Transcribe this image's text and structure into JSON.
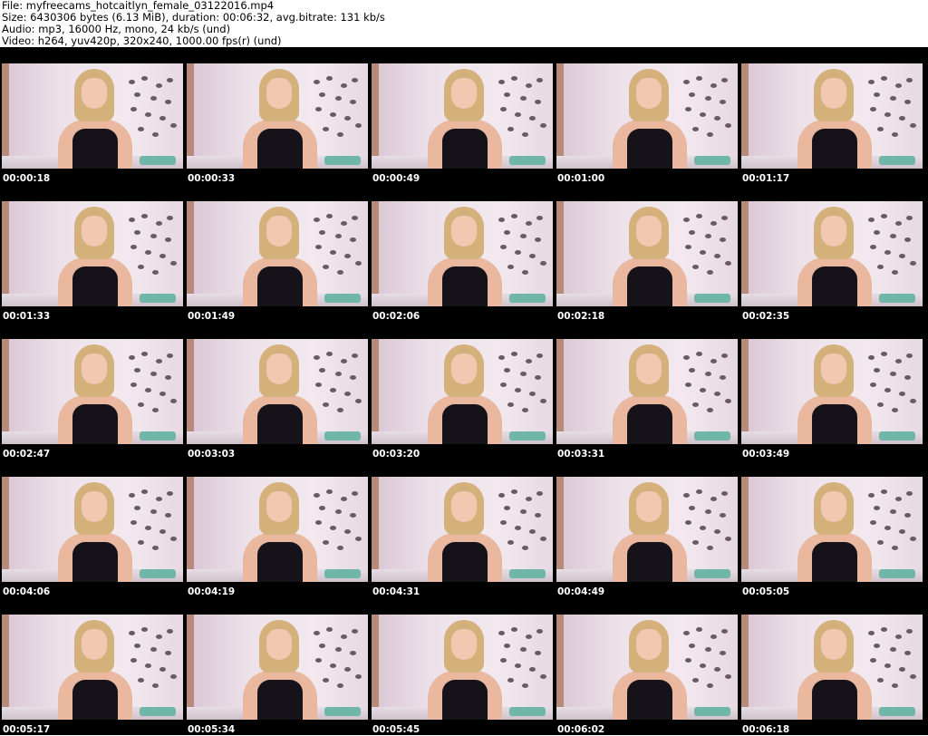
{
  "header": {
    "file": "File: myfreecams_hotcaitlyn_female_03122016.mp4",
    "size": "Size: 6430306 bytes (6.13 MiB), duration: 00:06:32, avg.bitrate: 131 kb/s",
    "audio": "Audio: mp3, 16000 Hz, mono, 24 kb/s (und)",
    "video": "Video: h264, yuv420p, 320x240, 1000.00 fps(r) (und)"
  },
  "thumbnails": [
    [
      "00:00:18",
      "00:00:33",
      "00:00:49",
      "00:01:00",
      "00:01:17"
    ],
    [
      "00:01:33",
      "00:01:49",
      "00:02:06",
      "00:02:18",
      "00:02:35"
    ],
    [
      "00:02:47",
      "00:03:03",
      "00:03:20",
      "00:03:31",
      "00:03:49"
    ],
    [
      "00:04:06",
      "00:04:19",
      "00:04:31",
      "00:04:49",
      "00:05:05"
    ],
    [
      "00:05:17",
      "00:05:34",
      "00:05:45",
      "00:06:02",
      "00:06:18"
    ]
  ],
  "colors": {
    "sheet_background": "#000000",
    "timestamp_text": "#ffffff"
  }
}
